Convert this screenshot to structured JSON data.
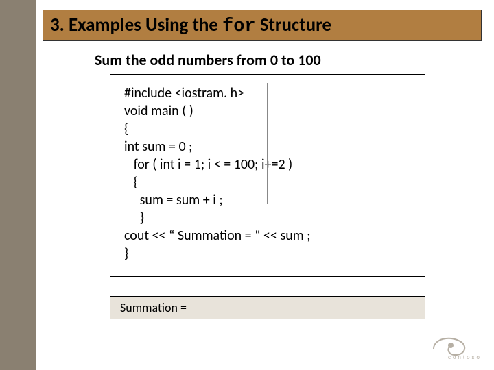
{
  "title": {
    "prefix": "3. Examples Using the ",
    "mono": "for",
    "suffix": " Structure"
  },
  "subtitle": "Sum the odd numbers from 0 to 100",
  "code": "#include <iostram. h>\nvoid main ( )\n{\nint sum = 0 ;\n   for ( int i = 1; i < = 100; i+=2 )\n   {\n     sum = sum + i ;\n     }\ncout << “ Summation = “ << sum ;\n}",
  "output_label": "Summation =",
  "logo_brand": "contoso"
}
